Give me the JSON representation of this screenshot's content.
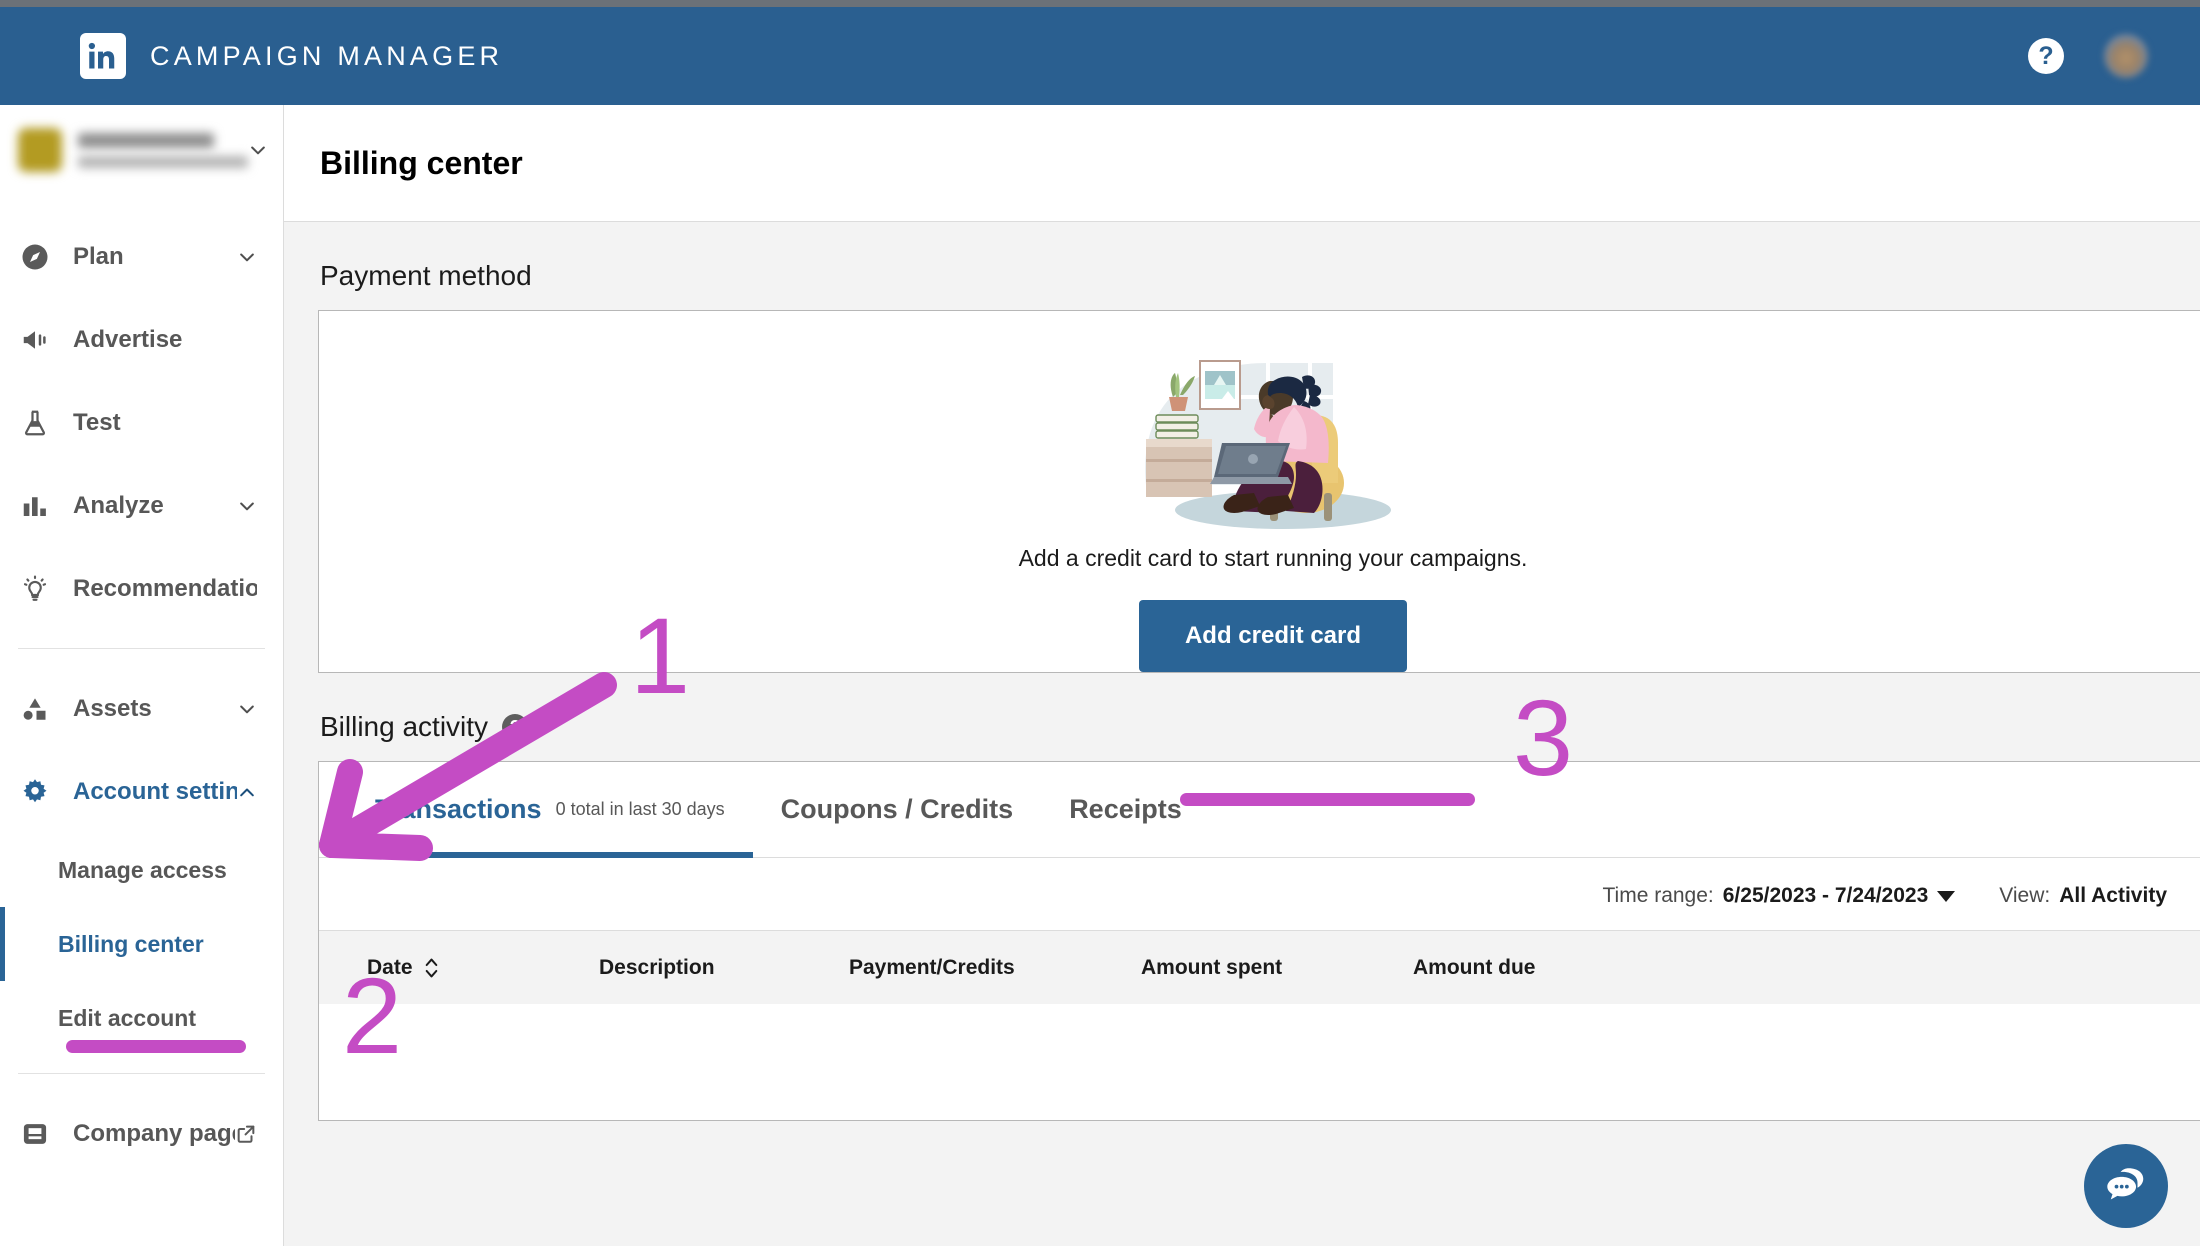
{
  "topbar": {
    "brand": "CAMPAIGN MANAGER",
    "logo_icon": "linkedin-logo-icon",
    "help_icon": "help-question-icon",
    "help_label": "?",
    "avatar_icon": "user-avatar"
  },
  "sidebar": {
    "account": {
      "name": "",
      "sublabel": "",
      "chevron_icon": "chevron-down-icon"
    },
    "items": [
      {
        "label": "Plan",
        "icon": "compass-icon",
        "expandable": true,
        "active": false
      },
      {
        "label": "Advertise",
        "icon": "megaphone-icon",
        "expandable": false,
        "active": false
      },
      {
        "label": "Test",
        "icon": "flask-icon",
        "expandable": false,
        "active": false
      },
      {
        "label": "Analyze",
        "icon": "bar-chart-icon",
        "expandable": true,
        "active": false
      },
      {
        "label": "Recommendations (B...",
        "icon": "lightbulb-icon",
        "expandable": false,
        "active": false
      }
    ],
    "items2": [
      {
        "label": "Assets",
        "icon": "shapes-icon",
        "expandable": true,
        "active": false
      },
      {
        "label": "Account settings",
        "icon": "gear-icon",
        "expandable": true,
        "active": true
      }
    ],
    "subitems": [
      {
        "label": "Manage access",
        "active": false
      },
      {
        "label": "Billing center",
        "active": true
      },
      {
        "label": "Edit account",
        "active": false
      }
    ],
    "footer": {
      "label": "Company page",
      "icon": "company-page-icon",
      "external_icon": "external-link-icon"
    }
  },
  "main": {
    "page_title": "Billing center",
    "payment_method": {
      "section_title": "Payment method",
      "illustration": "woman-at-laptop-illustration",
      "message": "Add a credit card to start running your campaigns.",
      "cta_label": "Add credit card"
    },
    "billing_activity": {
      "section_title": "Billing activity",
      "help_icon": "help-question-icon",
      "help_label": "?",
      "tabs": [
        {
          "label": "Transactions",
          "count": "0 total in last 30 days",
          "active": true
        },
        {
          "label": "Coupons / Credits",
          "count": "",
          "active": false
        },
        {
          "label": "Receipts",
          "count": "",
          "active": false
        }
      ],
      "filters": {
        "time_range_label": "Time range:",
        "time_range_value": "6/25/2023 - 7/24/2023",
        "view_label": "View:",
        "view_value": "All Activity",
        "caret_icon": "chevron-down-icon"
      },
      "table": {
        "columns": [
          "Date",
          "Description",
          "Payment/Credits",
          "Amount spent",
          "Amount due"
        ],
        "sort_icon": "sort-updown-icon",
        "rows": []
      }
    }
  },
  "annotations": {
    "color": "#c44cc4",
    "marks": [
      {
        "name": "step-1",
        "label": "1"
      },
      {
        "name": "step-2",
        "label": "2"
      },
      {
        "name": "step-3",
        "label": "3"
      }
    ],
    "arrow_icon": "arrow-pointing-left-icon"
  },
  "chat_widget": {
    "icon": "chat-bubbles-icon"
  }
}
